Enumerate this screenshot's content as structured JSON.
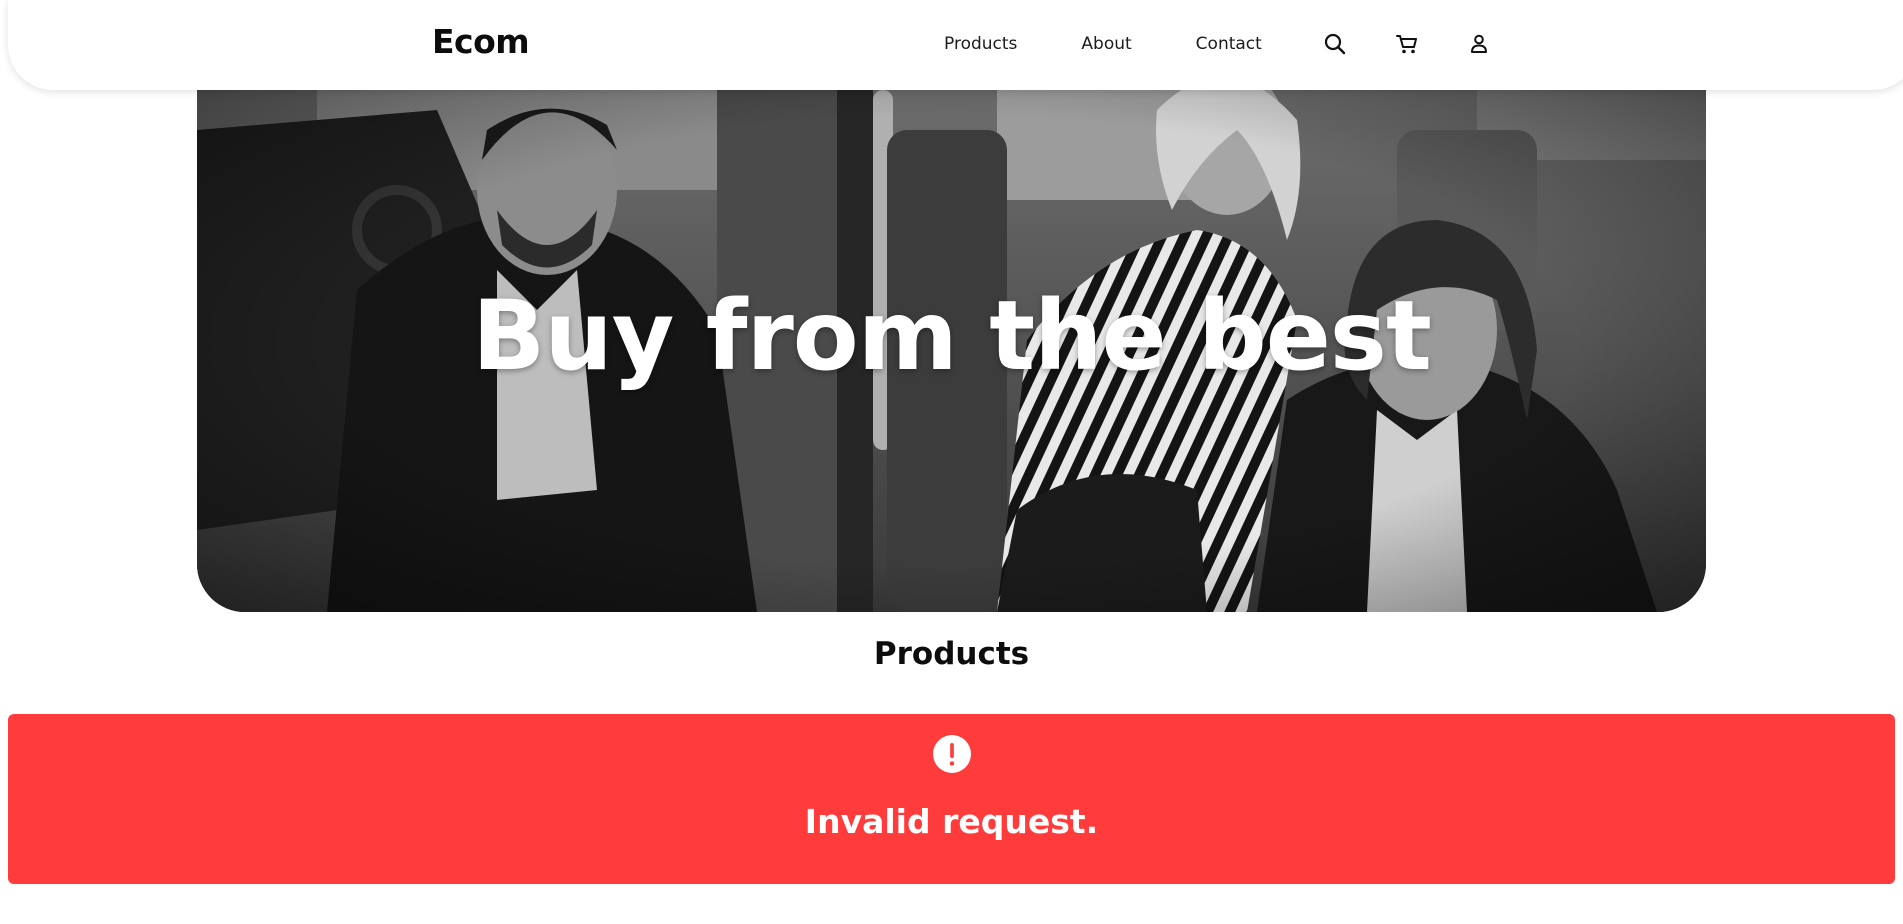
{
  "header": {
    "brand": "Ecom",
    "nav": [
      {
        "label": "Products"
      },
      {
        "label": "About"
      },
      {
        "label": "Contact"
      }
    ],
    "icons": [
      "search-icon",
      "cart-icon",
      "user-icon"
    ]
  },
  "hero": {
    "title": "Buy from the best"
  },
  "products": {
    "title": "Products"
  },
  "alert": {
    "icon": "exclamation-circle-icon",
    "message": "Invalid request.",
    "background_color": "#ff3b3b"
  }
}
